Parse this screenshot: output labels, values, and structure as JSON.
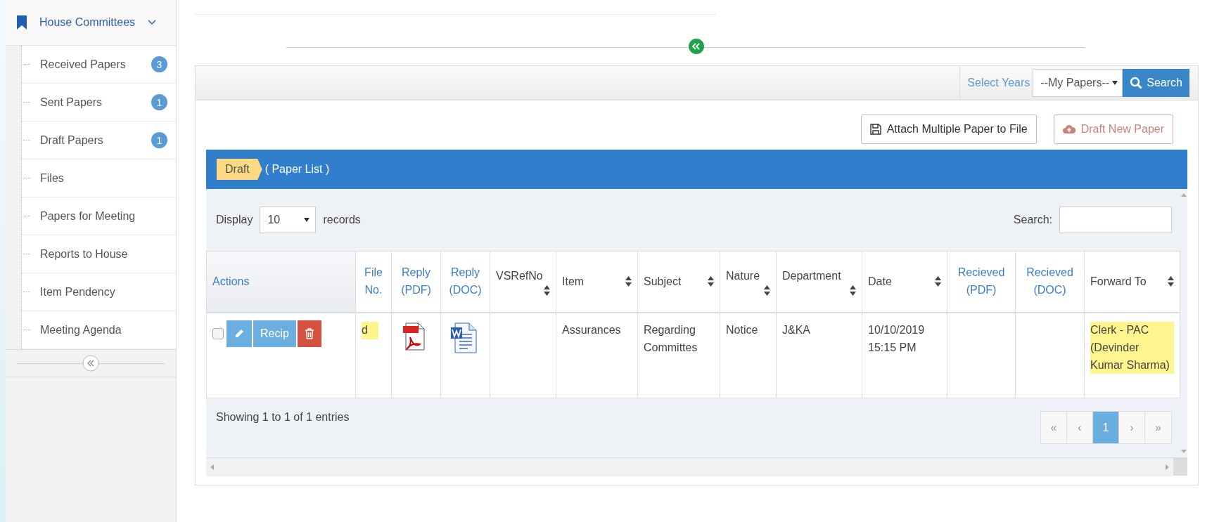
{
  "sidebar": {
    "title": "House Committees",
    "items": [
      {
        "label": "Received Papers",
        "badge": "3"
      },
      {
        "label": "Sent Papers",
        "badge": "1"
      },
      {
        "label": "Draft Papers",
        "badge": "1"
      },
      {
        "label": "Files"
      },
      {
        "label": "Papers for Meeting"
      },
      {
        "label": "Reports to House"
      },
      {
        "label": "Item Pendency"
      },
      {
        "label": "Meeting Agenda"
      }
    ]
  },
  "toolbar": {
    "label": "Select Years",
    "select": "--My Papers--",
    "button": "Search"
  },
  "actions": [
    {
      "label": "Attach Multiple Paper to File",
      "kind": "save"
    },
    {
      "label": "Draft New Paper",
      "kind": "upload"
    }
  ],
  "list_header": {
    "tag": "Draft",
    "title": "( Paper List )"
  },
  "table": {
    "display_label": "Display",
    "length": "10",
    "records_label": "records",
    "search_label": "Search:",
    "columns": [
      {
        "label": "Actions",
        "sortable": false
      },
      {
        "label": "File No.",
        "sortable": false
      },
      {
        "label": "Reply (PDF)",
        "sortable": false
      },
      {
        "label": "Reply (DOC)",
        "sortable": false
      },
      {
        "label": "VSRefNo",
        "sortable": true
      },
      {
        "label": "Item",
        "sortable": true
      },
      {
        "label": "Subject",
        "sortable": true
      },
      {
        "label": "Nature",
        "sortable": true
      },
      {
        "label": "Department",
        "sortable": true
      },
      {
        "label": "Date",
        "sortable": true
      },
      {
        "label": "Recieved (PDF)",
        "sortable": false
      },
      {
        "label": "Recieved (DOC)",
        "sortable": false
      },
      {
        "label": "Forward To",
        "sortable": true
      }
    ],
    "rows": [
      {
        "cells": [
          {
            "kind": "actions",
            "checked": false,
            "button": "Recip"
          },
          {
            "kind": "text",
            "text": "d",
            "highlighted": true
          },
          {
            "kind": "pdf"
          },
          {
            "kind": "doc"
          },
          {
            "kind": "empty"
          },
          {
            "kind": "text",
            "text": "Assurances",
            "highlighted": false
          },
          {
            "kind": "text",
            "text": "Regarding Committes",
            "highlighted": false
          },
          {
            "kind": "text",
            "text": "Notice",
            "highlighted": false
          },
          {
            "kind": "text",
            "text": "J&KA",
            "highlighted": false
          },
          {
            "kind": "text",
            "text": "10/10/2019 15:15 PM",
            "highlighted": false
          },
          {
            "kind": "empty"
          },
          {
            "kind": "empty"
          },
          {
            "kind": "text",
            "text": "Clerk - PAC (Devinder Kumar Sharma)",
            "highlighted": true
          }
        ]
      }
    ],
    "info": "Showing 1 to 1 of 1 entries",
    "pagination": [
      {
        "label": "«",
        "selected": false
      },
      {
        "label": "‹",
        "selected": false
      },
      {
        "label": "1",
        "selected": true
      },
      {
        "label": "›",
        "selected": false
      },
      {
        "label": "»",
        "selected": false
      }
    ]
  }
}
